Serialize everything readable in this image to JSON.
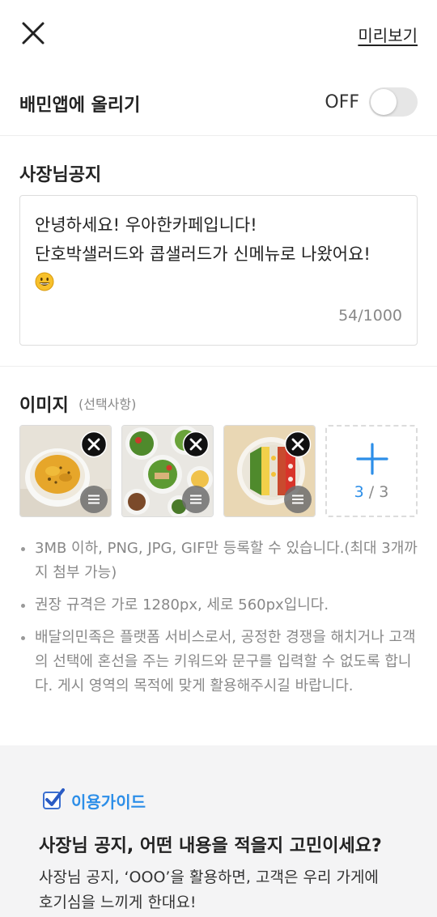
{
  "header": {
    "preview_label": "미리보기"
  },
  "baemin_toggle": {
    "title": "배민앱에 올리기",
    "state_label": "OFF",
    "enabled": false
  },
  "owner_notice": {
    "title": "사장님공지",
    "line1": "안녕하세요! 우아한카페입니다!",
    "line2": "단호박샐러드와 콥샐러드가 신메뉴로 나왔어요!",
    "emoji": "😀",
    "counter": "54/1000"
  },
  "images": {
    "title": "이미지",
    "subtitle": "(선택사항)",
    "thumbnails": [
      {
        "description_icon": "pumpkin-salad-photo"
      },
      {
        "description_icon": "salad-table-photo"
      },
      {
        "description_icon": "cobb-salad-photo"
      }
    ],
    "count_current": "3",
    "count_sep": " / ",
    "count_max": "3",
    "notes": [
      "3MB 이하, PNG, JPG, GIF만 등록할 수 있습니다.(최대 3개까지 첨부 가능)",
      "권장 규격은 가로 1280px, 세로 560px입니다.",
      "배달의민족은 플랫폼 서비스로서, 공정한 경쟁을 해치거나 고객의 선택에 혼선을 주는 키워드와 문구를 입력할 수 없도록 합니다. 게시 영역의 목적에 맞게 활용해주시길 바랍니다."
    ]
  },
  "guide": {
    "label": "이용가이드",
    "heading": "사장님 공지, 어떤 내용을 적을지 고민이세요?",
    "body_line1": "사장님 공지, ‘OOO’을 활용하면, 고객은 우리 가게에",
    "body_line2": "호기심을 느끼게 한대요!"
  },
  "colors": {
    "accent": "#2c8ee8",
    "text": "#222222",
    "muted": "#888888",
    "guide_bg": "#f4f4f5"
  }
}
